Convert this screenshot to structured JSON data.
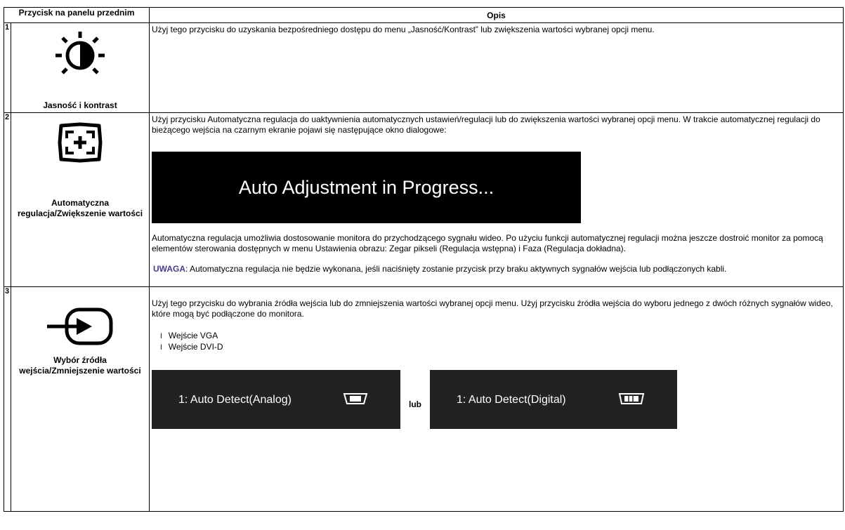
{
  "header": {
    "col_button": "Przycisk na panelu przednim",
    "col_desc": "Opis"
  },
  "rows": [
    {
      "num": "1",
      "icon": "brightness-contrast-icon",
      "label": "Jasność i kontrast",
      "desc": "Użyj tego przycisku do uzyskania bezpośredniego dostępu do menu „Jasność/Kontrast” lub zwiększenia wartości wybranej opcji menu."
    },
    {
      "num": "2",
      "icon": "auto-adjust-icon",
      "label": "Automatyczna regulacja/Zwiększenie wartości",
      "desc": "Użyj przycisku Automatyczna regulacja do uaktywnienia automatycznych ustawień/regulacji lub do zwiększenia wartości wybranej opcji menu. W trakcie automatycznej regulacji do bieżącego wejścia na czarnym ekranie pojawi się następujące okno dialogowe:",
      "osd_text": "Auto Adjustment in Progress...",
      "desc2": "Automatyczna regulacja umożliwia dostosowanie monitora do przychodzącego sygnału wideo. Po użyciu funkcji automatycznej regulacji można jeszcze dostroić monitor za pomocą elementów sterowania dostępnych w menu Ustawienia obrazu: Zegar pikseli (Regulacja wstępna) i Faza (Regulacja dokładna).",
      "note_label": "UWAGA",
      "note_text": ": Automatyczna regulacja nie będzie wykonana, jeśli naciśnięty zostanie przycisk przy braku aktywnych sygnałów wejścia lub podłączonych kabli."
    },
    {
      "num": "3",
      "icon": "input-source-icon",
      "label": "Wybór źródła wejścia/Zmniejszenie wartości",
      "desc": "Użyj tego przycisku do wybrania źródła wejścia lub do zmniejszenia wartości wybranej opcji menu. Użyj przycisku źródła wejścia do wyboru jednego z dwóch różnych sygnałów wideo, które mogą być podłączone do monitora.",
      "bullets": [
        "Wejście VGA",
        "Wejście DVI-D"
      ],
      "osd_left": "1: Auto Detect(Analog)",
      "osd_sep": "lub",
      "osd_right": "1: Auto Detect(Digital)"
    }
  ],
  "colors": {
    "note": "#4a3c8c",
    "osd_bg": "#000000",
    "osd_small_bg": "#222222"
  }
}
